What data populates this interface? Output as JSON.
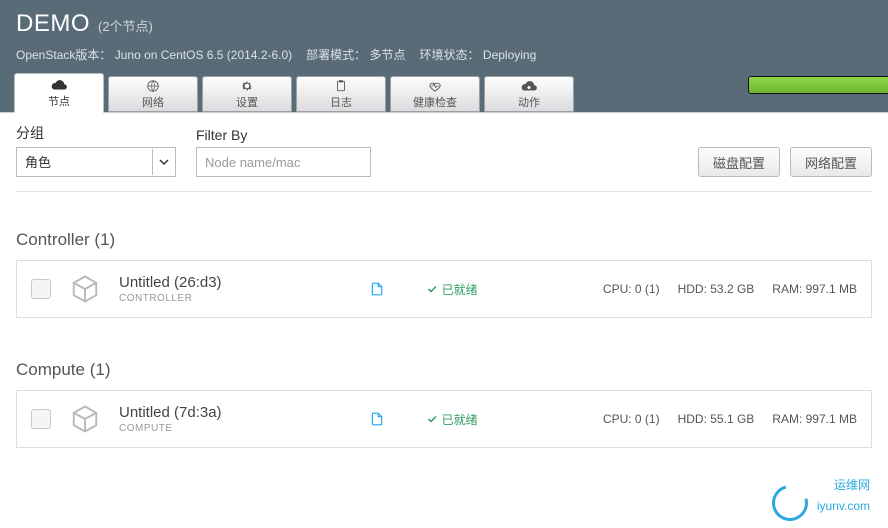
{
  "header": {
    "title": "DEMO",
    "subtitle": "(2个节点)",
    "info": {
      "version_label": "OpenStack版本：",
      "version_value": "Juno on CentOS 6.5 (2014.2-6.0)",
      "deploy_mode_label": "部署模式：",
      "deploy_mode_value": "多节点",
      "env_status_label": "环境状态：",
      "env_status_value": "Deploying"
    }
  },
  "tabs": [
    {
      "label": "节点",
      "icon": "cloud-icon",
      "active": true
    },
    {
      "label": "网络",
      "icon": "globe-icon",
      "active": false
    },
    {
      "label": "设置",
      "icon": "gear-icon",
      "active": false
    },
    {
      "label": "日志",
      "icon": "clipboard-icon",
      "active": false
    },
    {
      "label": "健康检查",
      "icon": "heartbeat-icon",
      "active": false
    },
    {
      "label": "动作",
      "icon": "cloud-action-icon",
      "active": false
    }
  ],
  "filter": {
    "group_label": "分组",
    "group_select_value": "角色",
    "group_options": [
      "角色"
    ],
    "filter_by_label": "Filter By",
    "filter_placeholder": "Node name/mac"
  },
  "buttons": {
    "disk_config": "磁盘配置",
    "network_config": "网络配置"
  },
  "groups": [
    {
      "title": "Controller (1)",
      "nodes": [
        {
          "name": "Untitled (26:d3)",
          "role": "CONTROLLER",
          "status": "已就绪",
          "cpu": "CPU: 0 (1)",
          "hdd": "HDD: 53.2 GB",
          "ram": "RAM: 997.1 MB"
        }
      ]
    },
    {
      "title": "Compute (1)",
      "nodes": [
        {
          "name": "Untitled (7d:3a)",
          "role": "COMPUTE",
          "status": "已就绪",
          "cpu": "CPU: 0 (1)",
          "hdd": "HDD: 55.1 GB",
          "ram": "RAM: 997.1 MB"
        }
      ]
    }
  ],
  "watermark": {
    "text1": "运维网",
    "text2": "iyunv.com"
  }
}
